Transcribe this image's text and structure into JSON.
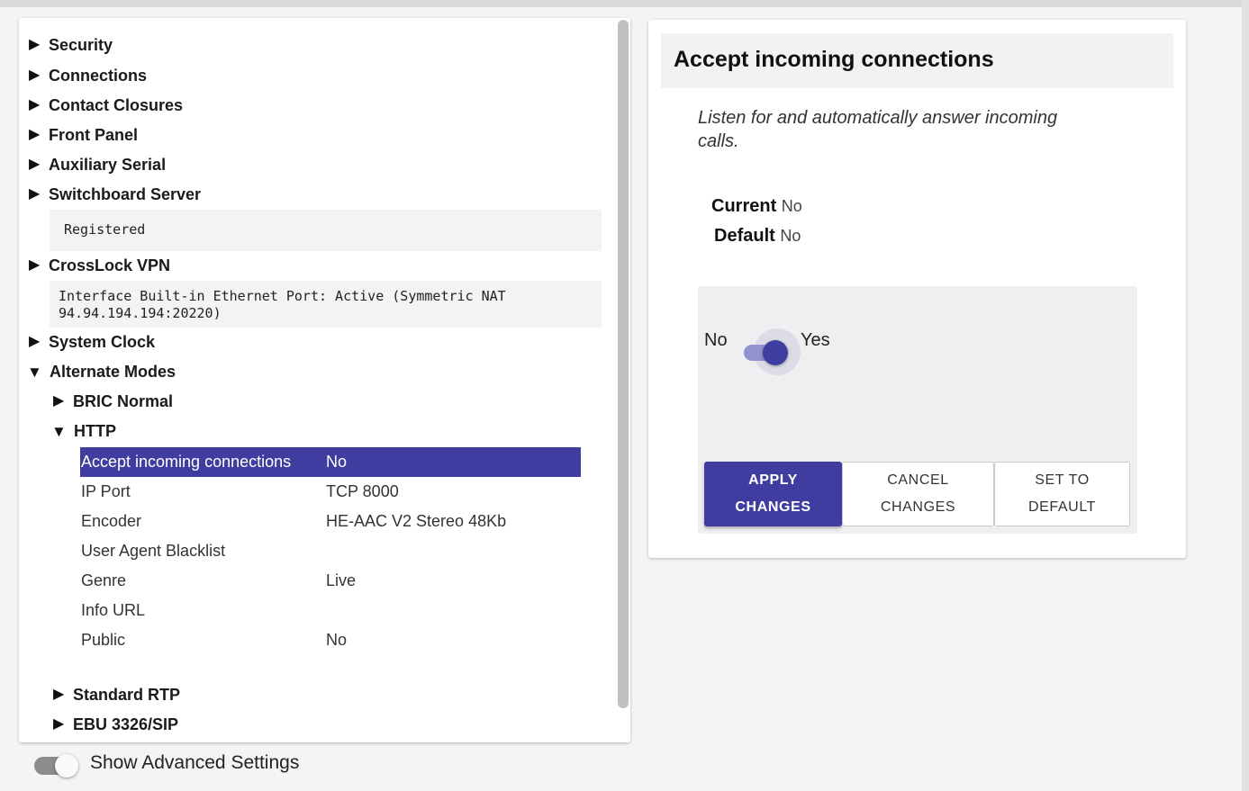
{
  "tree": {
    "items": [
      {
        "label": "Security",
        "expanded": false
      },
      {
        "label": "Connections",
        "expanded": false
      },
      {
        "label": "Contact Closures",
        "expanded": false
      },
      {
        "label": "Front Panel",
        "expanded": false
      },
      {
        "label": "Auxiliary Serial",
        "expanded": false
      },
      {
        "label": "Switchboard Server",
        "expanded": false
      },
      {
        "label": "CrossLock VPN",
        "expanded": false
      },
      {
        "label": "System Clock",
        "expanded": false
      },
      {
        "label": "Alternate Modes",
        "expanded": true
      }
    ],
    "switchboard_status": "Registered",
    "crosslock_status": "Interface Built-in Ethernet Port: Active (Symmetric NAT\n94.94.194.194:20220)",
    "alternate_modes": {
      "children": [
        {
          "label": "BRIC Normal",
          "expanded": false
        },
        {
          "label": "HTTP",
          "expanded": true
        },
        {
          "label": "Standard RTP",
          "expanded": false
        },
        {
          "label": "EBU 3326/SIP",
          "expanded": false
        }
      ],
      "http_settings": [
        {
          "name": "Accept incoming connections",
          "value": "No",
          "selected": true
        },
        {
          "name": "IP Port",
          "value": "TCP 8000"
        },
        {
          "name": "Encoder",
          "value": "HE-AAC V2 Stereo 48Kb"
        },
        {
          "name": "User Agent Blacklist",
          "value": ""
        },
        {
          "name": "Genre",
          "value": "Live"
        },
        {
          "name": "Info URL",
          "value": ""
        },
        {
          "name": "Public",
          "value": "No"
        }
      ]
    },
    "caret_collapsed": "▶",
    "caret_expanded": "▼"
  },
  "advanced_toggle": {
    "label": "Show Advanced Settings",
    "on": false
  },
  "detail": {
    "title": "Accept incoming connections",
    "description": "Listen for and automatically answer incoming calls.",
    "current_label": "Current",
    "current_value": "No",
    "default_label": "Default",
    "default_value": "No",
    "switch_off_label": "No",
    "switch_on_label": "Yes",
    "switch_on": true,
    "buttons": {
      "apply": "APPLY\nCHANGES",
      "cancel": "CANCEL\nCHANGES",
      "set_default": "SET TO\nDEFAULT"
    }
  },
  "colors": {
    "accent": "#3f3ea0",
    "selected_row_bg": "#3f3ea0",
    "switch_track_on": "#9293cf"
  }
}
